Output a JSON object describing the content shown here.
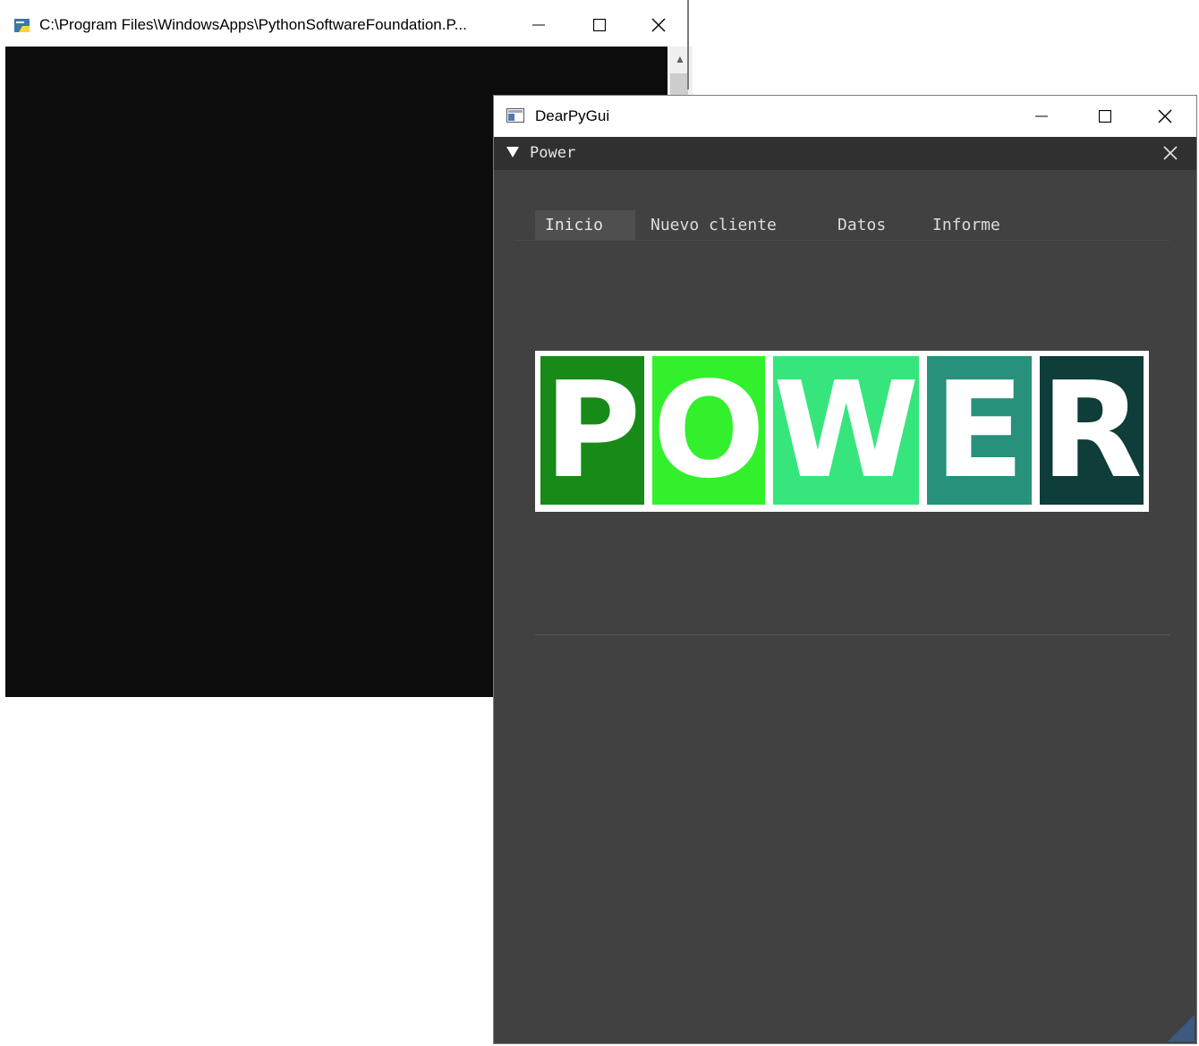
{
  "console_window": {
    "title": "C:\\Program Files\\WindowsApps\\PythonSoftwareFoundation.P...",
    "icon": "python-icon",
    "body_color": "#0c0c0c"
  },
  "app_window": {
    "title": "DearPyGui",
    "icon": "app-window-icon"
  },
  "inner_window": {
    "title": "Power",
    "tabs": [
      {
        "label": "Inicio",
        "active": true
      },
      {
        "label": "Nuevo cliente",
        "active": false
      },
      {
        "label": "Datos",
        "active": false
      },
      {
        "label": "Informe",
        "active": false
      }
    ]
  },
  "logo": {
    "letters": [
      "P",
      "O",
      "W",
      "E",
      "R"
    ],
    "colors": [
      "#188a18",
      "#33f02d",
      "#36e67d",
      "#27917b",
      "#0e3d3a"
    ]
  }
}
